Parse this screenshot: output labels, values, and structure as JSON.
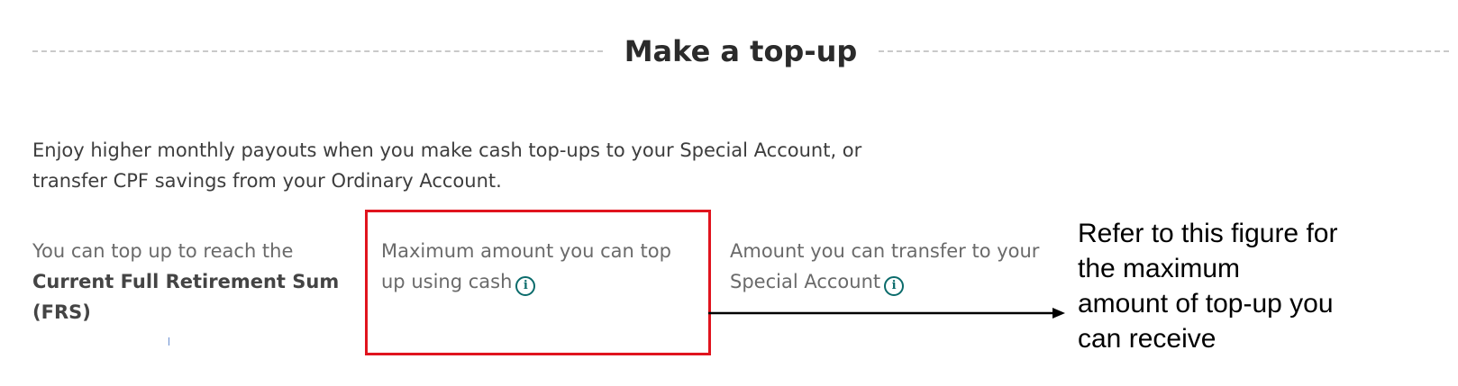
{
  "section": {
    "title": "Make a top-up"
  },
  "intro": {
    "line1": "Enjoy higher monthly payouts when you make cash top-ups to your Special Account, or",
    "line2": "transfer CPF savings from your Ordinary Account."
  },
  "columns": {
    "frs": {
      "text": "You can top up to reach the",
      "emphasis": "Current Full Retirement Sum (FRS)"
    },
    "cash_max": {
      "text": "Maximum amount you can top up using cash",
      "icon": "info-icon"
    },
    "transfer": {
      "text": "Amount you can transfer to your Special Account",
      "icon": "info-icon"
    }
  },
  "annotation": {
    "line1": "Refer to this figure for",
    "line2": "the maximum",
    "line3": "amount of top-up you",
    "line4": "can receive",
    "box_color": "#e0141e",
    "arrow_color": "#000000"
  },
  "colors": {
    "accent": "#0b6b6b",
    "text": "#3d3d3d"
  }
}
